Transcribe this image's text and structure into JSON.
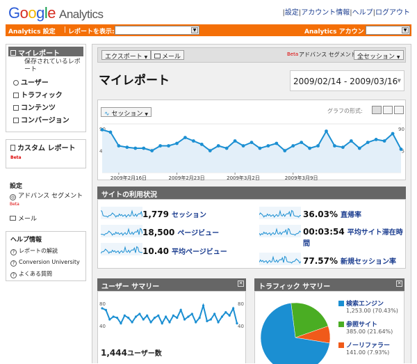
{
  "header": {
    "logo_google": "Google",
    "logo_analytics": "Analytics",
    "links": [
      "設定",
      "アカウント情報",
      "ヘルプ",
      "ログアウト"
    ]
  },
  "orangebar": {
    "settings": "Analytics 設定",
    "report_label": "レポートを表示:",
    "account_label": "Analytics アカウント:"
  },
  "sidebar": {
    "nav_active": "マイレポート",
    "saved_reports": "保存されているレポート",
    "items": [
      "ユーザー",
      "トラフィック",
      "コンテンツ",
      "コンバージョン"
    ],
    "custom_reports": "カスタム レポート",
    "beta": "Beta",
    "settings_title": "設定",
    "advanced_segments": "アドバンス セグメント",
    "email": "メール",
    "help_title": "ヘルプ情報",
    "help_items": [
      "レポートの解説",
      "Conversion University",
      "よくある質問"
    ]
  },
  "toolbar": {
    "export": "エクスポート",
    "email": "メール",
    "beta": "Beta",
    "advanced_segment": "アドバンス セグメント:",
    "segment_value": "全セッション"
  },
  "page": {
    "title": "マイレポート",
    "date_range": "2009/02/14 - 2009/03/16"
  },
  "main_chart": {
    "metric": "セッション",
    "graph_format": "グラフの形式:"
  },
  "chart_data": {
    "type": "line",
    "x_labels": [
      "2009年2月16日",
      "2009年2月23日",
      "2009年3月2日",
      "2009年3月9日"
    ],
    "ytick_left": [
      "90",
      "45"
    ],
    "ytick_right": [
      "90",
      "45"
    ],
    "ylim": [
      0,
      100
    ],
    "series": [
      {
        "values": [
          88,
          83,
          55,
          52,
          50,
          50,
          45,
          55,
          55,
          60,
          72,
          65,
          58,
          45,
          55,
          50,
          65,
          55,
          62,
          50,
          55,
          60,
          45,
          55,
          62,
          50,
          55,
          85,
          55,
          52,
          65,
          50,
          62,
          68,
          65,
          80,
          48
        ]
      }
    ]
  },
  "site_usage": {
    "title": "サイトの利用状況",
    "stats": [
      {
        "value": "1,779",
        "label": "セッション"
      },
      {
        "value": "18,500",
        "label": "ページビュー"
      },
      {
        "value": "10.40",
        "label": "平均ページビュー"
      },
      {
        "value": "36.03%",
        "label": "直帰率"
      },
      {
        "value": "00:03:54",
        "label": "平均サイト滞在時間"
      },
      {
        "value": "77.57%",
        "label": "新規セッション率"
      }
    ]
  },
  "user_summary": {
    "title": "ユーザー サマリー",
    "ytick_top": "80",
    "ytick_bottom": "40",
    "ytick_top_r": "80",
    "ytick_bottom_r": "40",
    "value": "1,444",
    "label": "ユーザー数",
    "spark": [
      75,
      72,
      55,
      60,
      58,
      48,
      62,
      58,
      50,
      60,
      65,
      55,
      62,
      50,
      58,
      62,
      48,
      60,
      50,
      62,
      58,
      72,
      55,
      60,
      65,
      50,
      58,
      80,
      52,
      55,
      65,
      50,
      60,
      68,
      62,
      75,
      48
    ]
  },
  "traffic_summary": {
    "title": "トラフィック サマリー",
    "legend": [
      {
        "name": "検索エンジン",
        "value": "1,253.00 (70.43%)",
        "color": "#1b8fd2"
      },
      {
        "name": "参照サイト",
        "value": "385.00 (21.64%)",
        "color": "#4aad23"
      },
      {
        "name": "ノーリファラー",
        "value": "141.00 (7.93%)",
        "color": "#f05a1a"
      }
    ],
    "pie_percent": [
      70.43,
      21.64,
      7.93
    ]
  }
}
